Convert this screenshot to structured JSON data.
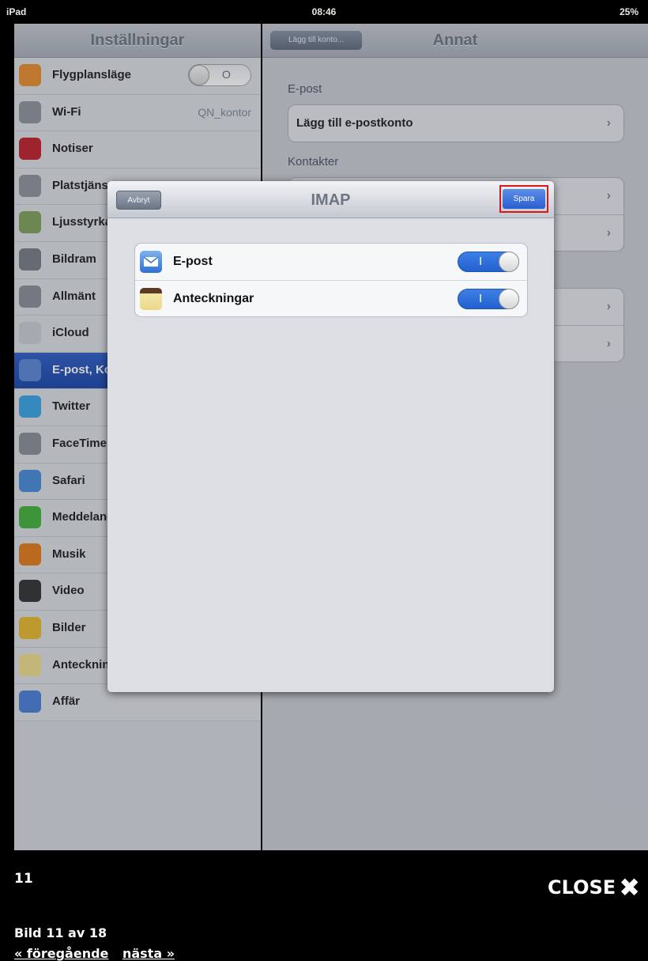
{
  "status_bar": {
    "device": "iPad",
    "time": "08:46",
    "battery": "25%"
  },
  "settings": {
    "title": "Inställningar",
    "items": [
      {
        "label": "Flygplansläge",
        "icon": "airplane-icon",
        "color": "#e88c2c",
        "toggle": "O"
      },
      {
        "label": "Wi-Fi",
        "icon": "wifi-icon",
        "color": "#8e939b",
        "value": "QN_kontor"
      },
      {
        "label": "Notiser",
        "icon": "notifications-icon",
        "color": "#c0202a"
      },
      {
        "label": "Platstjänster",
        "icon": "location-icon",
        "color": "#8e939b"
      },
      {
        "label": "Ljusstyrka",
        "icon": "brightness-icon",
        "color": "#7fa05a"
      },
      {
        "label": "Bildram",
        "icon": "picture-frame-icon",
        "color": "#777c84"
      },
      {
        "label": "Allmänt",
        "icon": "gear-icon",
        "color": "#8a8f97"
      },
      {
        "label": "iCloud",
        "icon": "cloud-icon",
        "color": "#c8ccd2"
      },
      {
        "label": "E-post, Kontakter",
        "icon": "mail-icon",
        "color": "#5a86d6",
        "selected": true
      },
      {
        "label": "Twitter",
        "icon": "twitter-icon",
        "color": "#3aa3e3"
      },
      {
        "label": "FaceTime",
        "icon": "facetime-icon",
        "color": "#8a8f97"
      },
      {
        "label": "Safari",
        "icon": "safari-icon",
        "color": "#4a8ad6"
      },
      {
        "label": "Meddelanden",
        "icon": "messages-icon",
        "color": "#45b33a"
      },
      {
        "label": "Musik",
        "icon": "music-icon",
        "color": "#e37a1c"
      },
      {
        "label": "Video",
        "icon": "video-icon",
        "color": "#333333"
      },
      {
        "label": "Bilder",
        "icon": "sunflower-icon",
        "color": "#e7b92c"
      },
      {
        "label": "Anteckningar",
        "icon": "notes-icon",
        "color": "#eede8c"
      },
      {
        "label": "Affär",
        "icon": "store-icon",
        "color": "#4a7fd6"
      }
    ]
  },
  "detail": {
    "back_label": "Lägg till konto...",
    "title": "Annat",
    "mail_section": "E-post",
    "add_mail_account": "Lägg till e-postkonto",
    "contacts_section": "Kontakter"
  },
  "modal": {
    "title": "IMAP",
    "cancel_label": "Avbryt",
    "save_label": "Spara",
    "rows": [
      {
        "label": "E-post",
        "icon": "mail-icon",
        "state": "I"
      },
      {
        "label": "Anteckningar",
        "icon": "notes-icon",
        "state": "I"
      }
    ]
  },
  "caption": {
    "number": "11",
    "close_label": "CLOSE",
    "description": "Bild 11 av 18",
    "prev_label": "« föregående",
    "next_label": "nästa »"
  }
}
